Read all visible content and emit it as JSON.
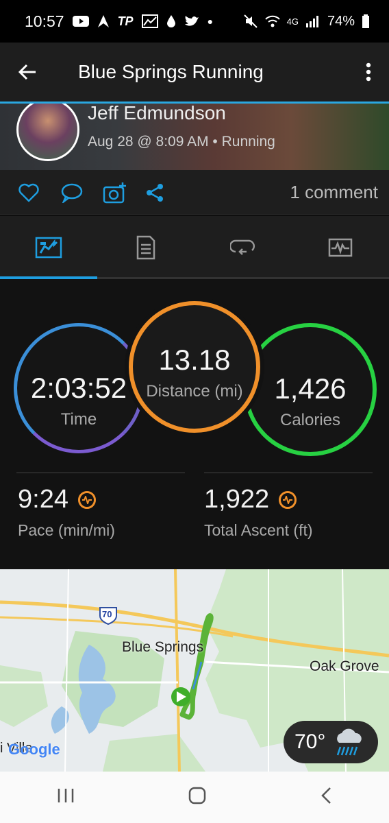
{
  "status": {
    "time": "10:57",
    "left_icons": [
      "youtube-icon",
      "garmin-icon",
      "tp-icon",
      "chart-icon",
      "drop-icon",
      "twitter-icon",
      "dot-icon"
    ],
    "tp_text": "TP",
    "network": "4G",
    "battery": "74%"
  },
  "appbar": {
    "title": "Blue Springs Running"
  },
  "profile": {
    "name": "Jeff Edmundson",
    "meta": "Aug 28 @ 8:09 AM • Running"
  },
  "actions": {
    "comments": "1 comment"
  },
  "tabs": [
    {
      "name": "overview",
      "icon": "summary-icon",
      "active": true
    },
    {
      "name": "details",
      "icon": "document-icon",
      "active": false
    },
    {
      "name": "laps",
      "icon": "repeat-icon",
      "active": false
    },
    {
      "name": "charts",
      "icon": "activity-chart-icon",
      "active": false
    }
  ],
  "stats": {
    "time": {
      "value": "2:03:52",
      "label": "Time"
    },
    "distance": {
      "value": "13.18",
      "label": "Distance (mi)"
    },
    "calories": {
      "value": "1,426",
      "label": "Calories"
    },
    "pace": {
      "value": "9:24",
      "label": "Pace (min/mi)"
    },
    "ascent": {
      "value": "1,922",
      "label": "Total Ascent (ft)"
    }
  },
  "map": {
    "labels": {
      "city": "Blue Springs",
      "town": "Oak Grove",
      "partial": "i Ville",
      "highway": "70",
      "brand": "Google"
    },
    "weather": {
      "temp": "70°",
      "icon": "rain-cloud-icon"
    }
  },
  "colors": {
    "accent": "#1e9ee0",
    "time_ring": "#6f5fc8",
    "distance_ring": "#f0902a",
    "calories_ring": "#27d142"
  }
}
